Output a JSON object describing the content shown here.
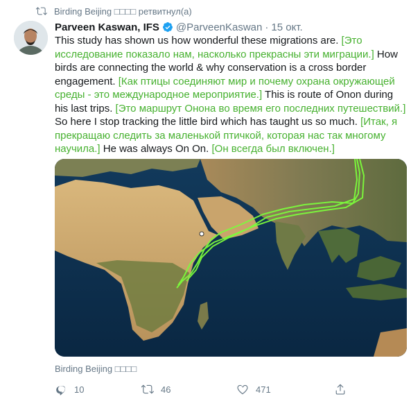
{
  "retweet": {
    "icon": "retweet-icon",
    "text": "Birding Beijing □□□□ ретвитнул(а)"
  },
  "tweet": {
    "author_name": "Parveen Kaswan, IFS",
    "verified_icon": "verified-badge-icon",
    "handle": "@ParveenKaswan",
    "separator": "·",
    "timestamp": "15 окт.",
    "segments": [
      {
        "text": "This study has shown us how wonderful these migrations are. ",
        "translated": false
      },
      {
        "text": "[Это исследование показало нам, насколько прекрасны эти миграции.]",
        "translated": true
      },
      {
        "text": "  How birds are connecting the world & why conservation is a cross border engagement. ",
        "translated": false
      },
      {
        "text": "[Как птицы соединяют мир и почему охрана окружающей среды - это международное мероприятие.]",
        "translated": true
      },
      {
        "text": "  This is route of Onon during his last trips. ",
        "translated": false
      },
      {
        "text": "[Это маршрут Онона во время его последних путешествий.]",
        "translated": true
      },
      {
        "text": " So here I stop tracking the little bird which has taught us so much. ",
        "translated": false
      },
      {
        "text": "[Итак, я прекращаю следить за маленькой птичкой, которая нас так многому научила.]",
        "translated": true
      },
      {
        "text": "  He was always On On. ",
        "translated": false
      },
      {
        "text": "[Он всегда был включен.]",
        "translated": true
      }
    ],
    "translation_color": "#46b12f",
    "media": {
      "kind": "satellite map",
      "route_color": "#7CFC3C",
      "ocean_color": "#0c2f4e",
      "land_color": "#b58a55"
    }
  },
  "source_label": "Birding Beijing □□□□",
  "actions": {
    "reply": {
      "icon": "reply-icon",
      "count": "10"
    },
    "retweet": {
      "icon": "retweet-icon",
      "count": "46"
    },
    "like": {
      "icon": "heart-icon",
      "count": "471"
    },
    "share": {
      "icon": "share-icon"
    }
  },
  "colors": {
    "secondary_text": "#657786",
    "verified": "#1da1f2",
    "primary_text": "#14171a"
  }
}
